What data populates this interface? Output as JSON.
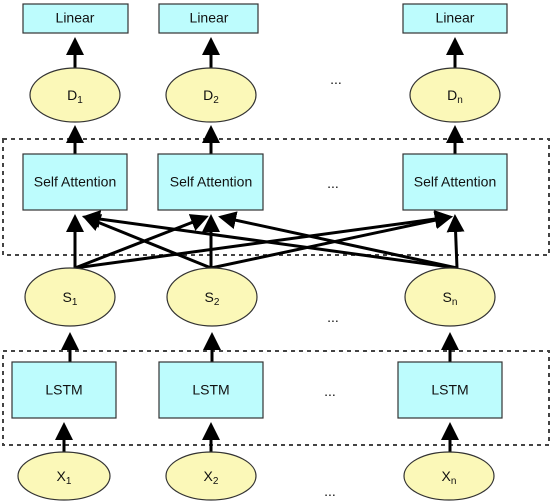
{
  "linear_label": "Linear",
  "attention_label": "Self Attention",
  "lstm_label": "LSTM",
  "ellipsis": "...",
  "d_nodes": [
    {
      "base": "D",
      "sub": "1"
    },
    {
      "base": "D",
      "sub": "2"
    },
    {
      "base": "D",
      "sub": "n"
    }
  ],
  "s_nodes": [
    {
      "base": "S",
      "sub": "1"
    },
    {
      "base": "S",
      "sub": "2"
    },
    {
      "base": "S",
      "sub": "n"
    }
  ],
  "x_nodes": [
    {
      "base": "X",
      "sub": "1"
    },
    {
      "base": "X",
      "sub": "2"
    },
    {
      "base": "X",
      "sub": "n"
    }
  ],
  "colors": {
    "box_fill": "#bdfcfd",
    "node_fill": "#fbf8b8",
    "stroke": "#000000"
  }
}
